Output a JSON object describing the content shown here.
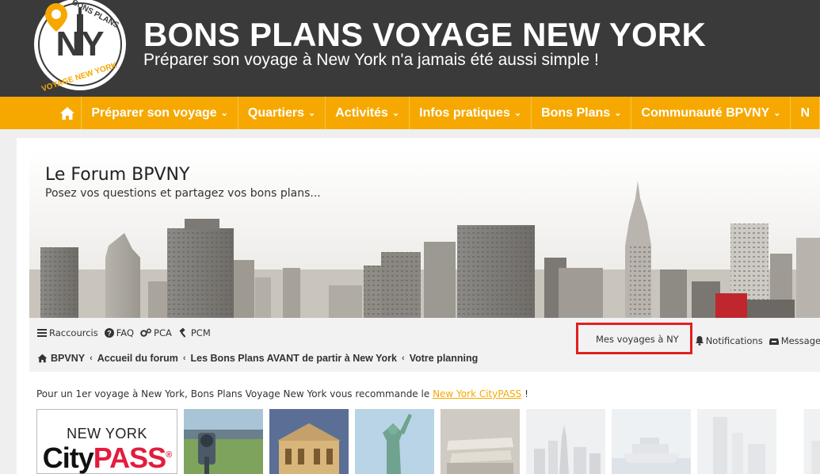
{
  "header": {
    "logo": {
      "top_text": "BONS PLANS",
      "bottom_text": "VOYAGE NEW YORK",
      "center": "NY"
    },
    "title": "BONS PLANS VOYAGE NEW YORK",
    "tagline": "Préparer son voyage à New York n'a jamais été aussi simple !"
  },
  "nav": {
    "home_icon": "home-icon",
    "items": [
      {
        "label": "Préparer son voyage"
      },
      {
        "label": "Quartiers"
      },
      {
        "label": "Activités"
      },
      {
        "label": "Infos pratiques"
      },
      {
        "label": "Bons Plans"
      },
      {
        "label": "Communauté BPVNY"
      },
      {
        "label": "N"
      }
    ]
  },
  "forum": {
    "title": "Le Forum BPVNY",
    "subtitle": "Posez vos questions et partagez vos bons plans...",
    "quicklinks": [
      {
        "label": "Raccourcis",
        "icon": "menu-icon"
      },
      {
        "label": "FAQ",
        "icon": "help-icon"
      },
      {
        "label": "PCA",
        "icon": "gears-icon"
      },
      {
        "label": "PCM",
        "icon": "gavel-icon"
      }
    ],
    "user_links": {
      "mes_voyages": "Mes voyages à NY",
      "notifications": "Notifications",
      "messages": "Messages privés"
    },
    "breadcrumb": [
      "BPVNY",
      "Accueil du forum",
      "Les Bons Plans AVANT de partir à New York",
      "Votre planning"
    ]
  },
  "promo": {
    "text": "Pour un 1er voyage à New York, Bons Plans Voyage New York vous recommande le",
    "link": "New York CityPASS",
    "suffix": " !",
    "card": {
      "line1": "NEW YORK",
      "city": "City",
      "pass": "PASS",
      "reg": "®"
    }
  },
  "colors": {
    "accent": "#f6a800",
    "header_bg": "#3a3a3a",
    "highlight_box": "#e02020",
    "citypass_red": "#e31c3d"
  }
}
